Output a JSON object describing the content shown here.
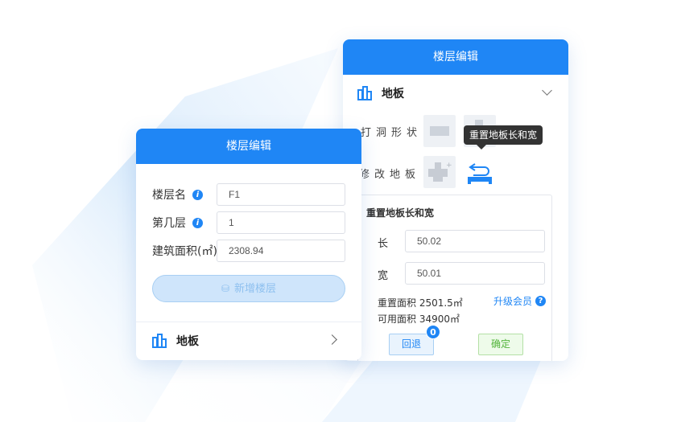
{
  "colors": {
    "primary": "#1f86f5",
    "success": "#52b43a"
  },
  "left_panel": {
    "title": "楼层编辑",
    "fields": [
      {
        "label": "楼层名",
        "value": "F1",
        "has_info": true
      },
      {
        "label": "第几层",
        "value": "1",
        "has_info": true
      },
      {
        "label": "建筑面积(㎡)",
        "value": "2308.94",
        "has_info": false
      }
    ],
    "add_button": "新增楼层",
    "floor_section": {
      "label": "地板",
      "icon": "building-icon"
    }
  },
  "right_panel": {
    "title": "楼层编辑",
    "section": {
      "label": "地板",
      "icon": "building-icon"
    },
    "hole_shape_label": "打洞形状",
    "modify_floor_label": "修改地板",
    "tooltip": "重置地板长和宽",
    "reset_box": {
      "title": "重置地板长和宽",
      "length_label": "长",
      "length_value": "50.02",
      "width_label": "宽",
      "width_value": "50.01",
      "reset_area": "重置面积 2501.5㎡",
      "usable_area": "可用面积 34900㎡",
      "upgrade": "升级会员",
      "back_button": "回退",
      "back_badge": "0",
      "confirm_button": "确定"
    }
  }
}
